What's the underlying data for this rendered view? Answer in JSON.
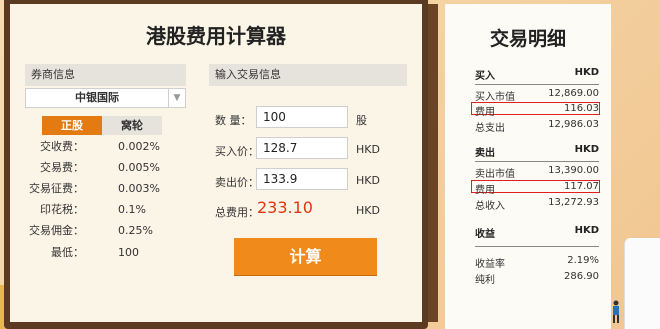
{
  "title": "港股费用计算器",
  "broker": {
    "header": "券商信息",
    "selected": "中银国际",
    "tabs": [
      "正股",
      "窝轮"
    ],
    "fees": [
      {
        "label": "交收费：",
        "value": "0.002%"
      },
      {
        "label": "交易费：",
        "value": "0.005%"
      },
      {
        "label": "交易征费：",
        "value": "0.003%"
      },
      {
        "label": "印花税：",
        "value": "0.1%"
      },
      {
        "label": "交易佣金：",
        "value": "0.25%"
      },
      {
        "label": "最低：",
        "value": "100"
      }
    ]
  },
  "input": {
    "header": "输入交易信息",
    "quantity_label": "数  量：",
    "quantity_value": "100",
    "quantity_unit": "股",
    "buy_label": "买入价：",
    "buy_value": "128.7",
    "buy_unit": "HKD",
    "sell_label": "卖出价：",
    "sell_value": "133.9",
    "sell_unit": "HKD",
    "total_label": "总费用：",
    "total_value": "233.10",
    "total_unit": "HKD",
    "calc_label": "计算"
  },
  "detail": {
    "title": "交易明细",
    "buy": {
      "header": "买入",
      "currency": "HKD",
      "rows": [
        {
          "label": "买入市值",
          "value": "12,869.00"
        },
        {
          "label": "费用",
          "value": "116.03"
        },
        {
          "label": "总支出",
          "value": "12,986.03"
        }
      ]
    },
    "sell": {
      "header": "卖出",
      "currency": "HKD",
      "rows": [
        {
          "label": "卖出市值",
          "value": "13,390.00"
        },
        {
          "label": "费用",
          "value": "117.07"
        },
        {
          "label": "总收入",
          "value": "13,272.93"
        }
      ]
    },
    "profit": {
      "header": "收益",
      "currency": "HKD",
      "rows": [
        {
          "label": "收益率",
          "value": "2.19%"
        },
        {
          "label": "纯利",
          "value": "286.90"
        }
      ]
    }
  },
  "colors": {
    "accent": "#f08a1a",
    "tab_active": "#e37b12",
    "total": "#e0350f",
    "highlight": "#e02020"
  }
}
